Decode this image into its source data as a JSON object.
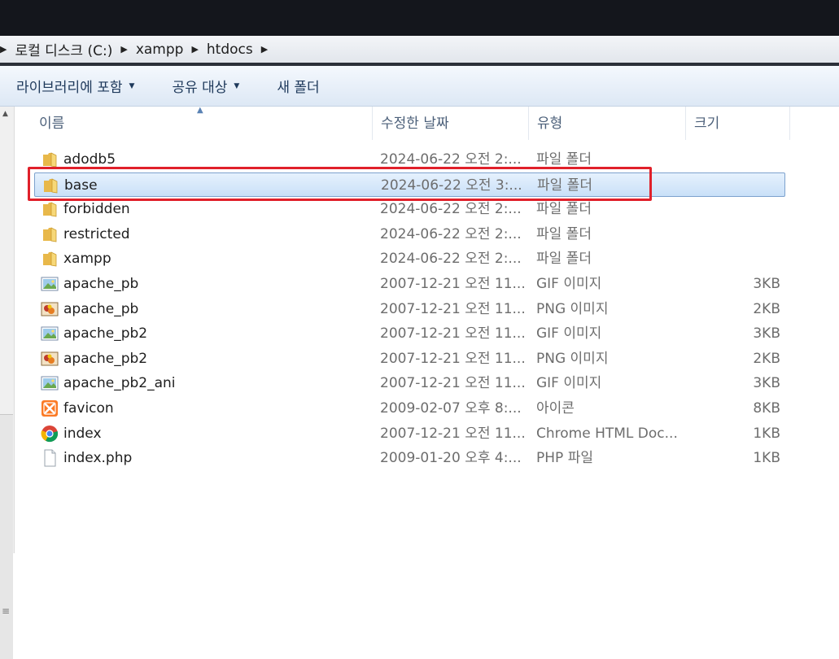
{
  "address": {
    "crumbs": [
      "로컬 디스크 (C:)",
      "xampp",
      "htdocs"
    ]
  },
  "toolbar": {
    "library_label": "라이브러리에 포함",
    "share_label": "공유 대상",
    "new_folder_label": "새 폴더"
  },
  "columns": {
    "name": "이름",
    "date": "수정한 날짜",
    "type": "유형",
    "size": "크기"
  },
  "files": [
    {
      "name": "adodb5",
      "date": "2024-06-22 오전 2:...",
      "type": "파일 폴더",
      "size": "",
      "icon": "folder-icon"
    },
    {
      "name": "base",
      "date": "2024-06-22 오전 3:...",
      "type": "파일 폴더",
      "size": "",
      "icon": "folder-icon",
      "selected": true
    },
    {
      "name": "forbidden",
      "date": "2024-06-22 오전 2:...",
      "type": "파일 폴더",
      "size": "",
      "icon": "folder-icon"
    },
    {
      "name": "restricted",
      "date": "2024-06-22 오전 2:...",
      "type": "파일 폴더",
      "size": "",
      "icon": "folder-icon"
    },
    {
      "name": "xampp",
      "date": "2024-06-22 오전 2:...",
      "type": "파일 폴더",
      "size": "",
      "icon": "folder-icon"
    },
    {
      "name": "apache_pb",
      "date": "2007-12-21 오전 11...",
      "type": "GIF 이미지",
      "size": "3KB",
      "icon": "gif-image-icon"
    },
    {
      "name": "apache_pb",
      "date": "2007-12-21 오전 11...",
      "type": "PNG 이미지",
      "size": "2KB",
      "icon": "png-image-icon"
    },
    {
      "name": "apache_pb2",
      "date": "2007-12-21 오전 11...",
      "type": "GIF 이미지",
      "size": "3KB",
      "icon": "gif-image-icon"
    },
    {
      "name": "apache_pb2",
      "date": "2007-12-21 오전 11...",
      "type": "PNG 이미지",
      "size": "2KB",
      "icon": "png-image-icon"
    },
    {
      "name": "apache_pb2_ani",
      "date": "2007-12-21 오전 11...",
      "type": "GIF 이미지",
      "size": "3KB",
      "icon": "gif-image-icon"
    },
    {
      "name": "favicon",
      "date": "2009-02-07 오후 8:...",
      "type": "아이콘",
      "size": "8KB",
      "icon": "xampp-favicon-icon"
    },
    {
      "name": "index",
      "date": "2007-12-21 오전 11...",
      "type": "Chrome HTML Doc...",
      "size": "1KB",
      "icon": "chrome-icon"
    },
    {
      "name": "index.php",
      "date": "2009-01-20 오후 4:...",
      "type": "PHP 파일",
      "size": "1KB",
      "icon": "blank-file-icon"
    }
  ],
  "colors": {
    "highlight": "#e0202a",
    "selection_border": "#7da2ce",
    "toolbar_text": "#1e395b"
  }
}
